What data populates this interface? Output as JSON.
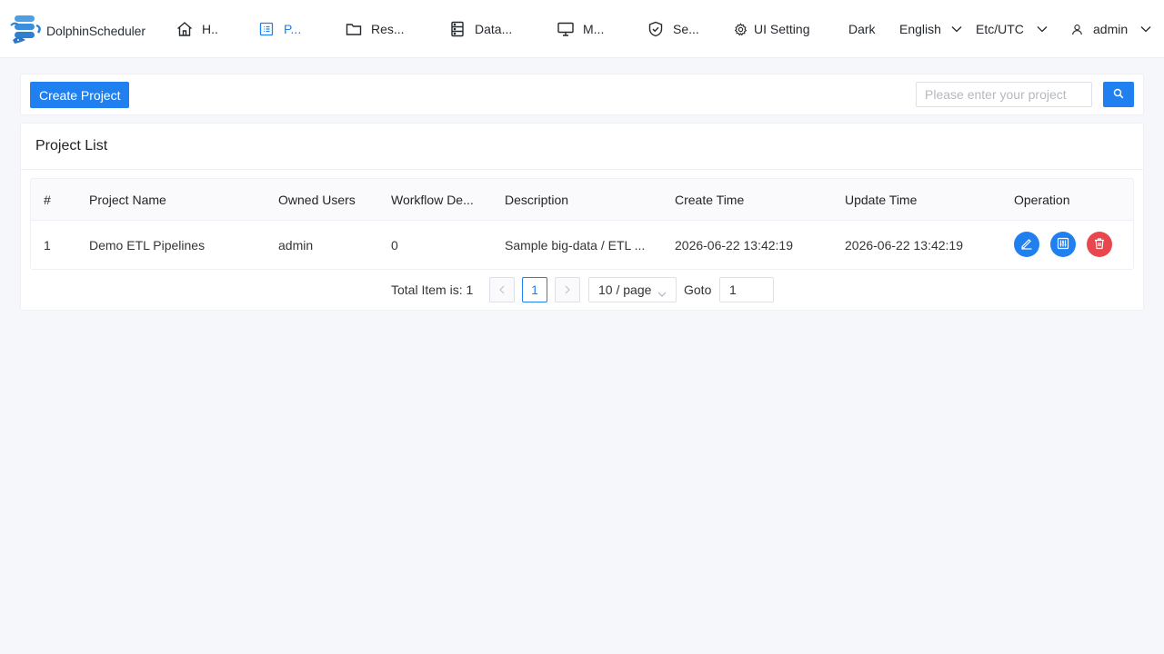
{
  "app": {
    "logo_text": "DolphinScheduler"
  },
  "nav": {
    "items": [
      {
        "label": "H..",
        "icon": "home-icon",
        "active": false
      },
      {
        "label": "P...",
        "icon": "project-icon",
        "active": true
      },
      {
        "label": "Res...",
        "icon": "folder-icon",
        "active": false
      },
      {
        "label": "Data...",
        "icon": "datasource-icon",
        "active": false
      },
      {
        "label": "M...",
        "icon": "monitor-icon",
        "active": false
      },
      {
        "label": "Se...",
        "icon": "shield-icon",
        "active": false
      }
    ],
    "ui_setting": "UI Setting",
    "theme": "Dark",
    "language": "English",
    "timezone": "Etc/UTC",
    "user": "admin"
  },
  "toolbar": {
    "create_label": "Create Project",
    "search_placeholder": "Please enter your project",
    "search_value": ""
  },
  "project_list": {
    "title": "Project List",
    "columns": [
      "#",
      "Project Name",
      "Owned Users",
      "Workflow De...",
      "Description",
      "Create Time",
      "Update Time",
      "Operation"
    ],
    "rows": [
      {
        "index": "1",
        "name": "Demo ETL Pipelines",
        "owner": "admin",
        "workflow_count": "0",
        "description": "Sample big-data / ETL ...",
        "create_time": "2026-06-22 13:42:19",
        "update_time": "2026-06-22 13:42:19"
      }
    ]
  },
  "pagination": {
    "total_text": "Total Item is: 1",
    "current_page": "1",
    "page_size": "10 / page",
    "goto_label": "Goto",
    "goto_value": "1"
  },
  "colors": {
    "primary": "#2080f0",
    "danger": "#e8484d",
    "background": "#f6f7fb"
  }
}
